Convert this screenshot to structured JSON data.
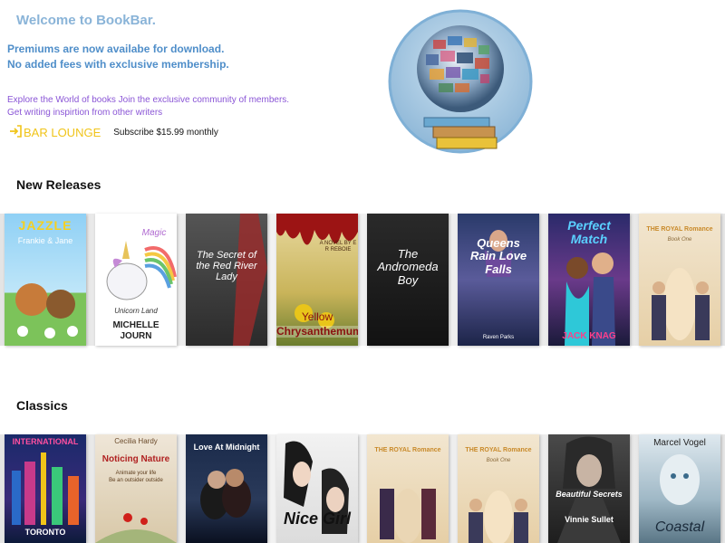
{
  "hero": {
    "title": "Welcome to BookBar.",
    "promo_line1": "Premiums are now availabe for download.",
    "promo_line2": "No added fees with exclusive membership.",
    "desc_line1": "Explore the World of books Join the exclusive community of members.",
    "desc_line2": "Get writing inspirtion from other writers",
    "lounge_label": "BAR LOUNGE",
    "subscribe_text": "Subscribe $15.99 monthly"
  },
  "sections": {
    "new_releases": {
      "title": "New Releases",
      "books": [
        {
          "t1": "JAZZLE",
          "t2": "Frankie & Jane"
        },
        {
          "t1": "Magic",
          "t2": "Unicorn Land",
          "t3": "MICHELLE",
          "t4": "JOURN"
        },
        {
          "t1": "The Secret of the Red River Lady"
        },
        {
          "t1": "A NOVEL BY E R REBOIE",
          "t2": "Yellow",
          "t3": "Chrysanthemums"
        },
        {
          "t1": "The Andromeda Boy"
        },
        {
          "t1": "Queens Rain Love Falls",
          "t2": "Raven Parks"
        },
        {
          "t1": "Perfect Match",
          "t2": "JACK KNAG"
        },
        {
          "t1": "THE ROYAL Romance",
          "t2": "Book One"
        }
      ]
    },
    "classics": {
      "title": "Classics",
      "books": [
        {
          "t1": "INTERNATIONAL",
          "t2": "TORONTO"
        },
        {
          "t1": "Cecilia Hardy",
          "t2": "Noticing Nature",
          "t3": "Animate your life",
          "t4": "Be an outsider outside"
        },
        {
          "t1": "Love At Midnight"
        },
        {
          "t1": "Nice Girl"
        },
        {
          "t1": "THE ROYAL Romance"
        },
        {
          "t1": "THE ROYAL Romance",
          "t2": "Book One"
        },
        {
          "t1": "Beautiful Secrets",
          "t2": "Vinnie Sullet"
        },
        {
          "t1": "Marcel Vogel",
          "t2": "Coastal"
        }
      ]
    }
  },
  "colors": {
    "title_blue": "#8ab4d8",
    "promo_blue": "#4f8ec9",
    "desc_purple": "#8a55d6",
    "lounge_yellow": "#f0c419"
  }
}
